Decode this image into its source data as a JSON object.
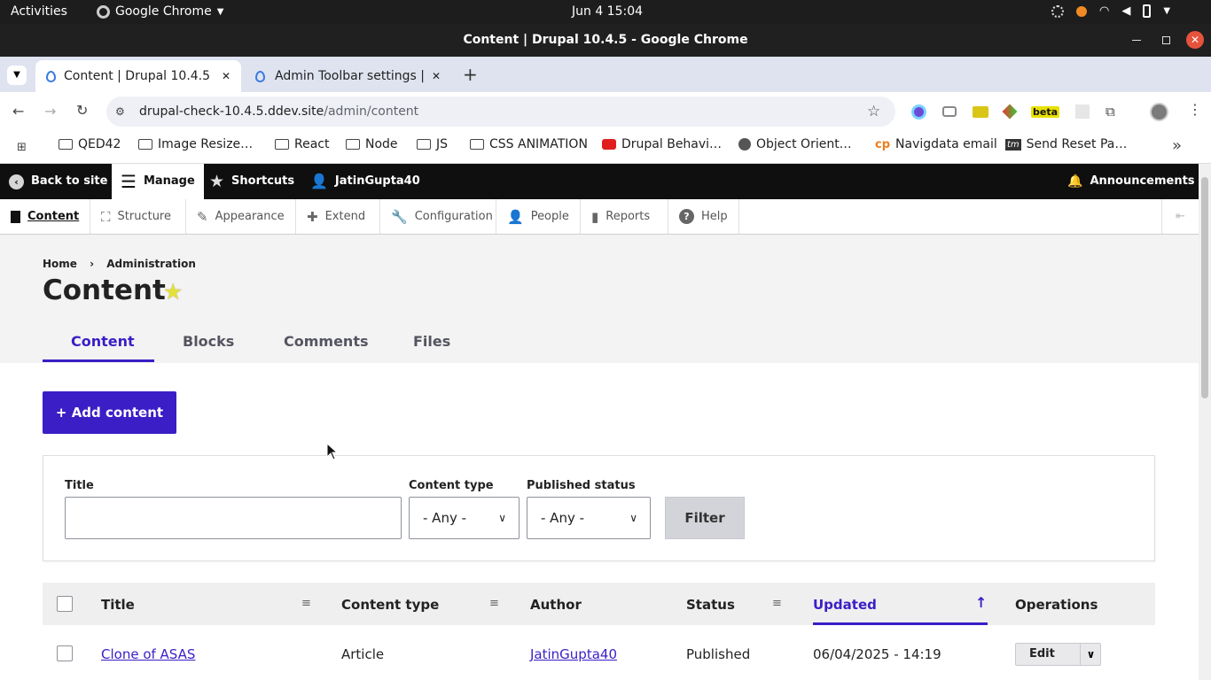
{
  "os": {
    "activities": "Activities",
    "app_name": "Google Chrome",
    "clock": "Jun 4  15:04"
  },
  "window": {
    "title": "Content | Drupal 10.4.5 - Google Chrome"
  },
  "tabs": [
    {
      "label": "Content | Drupal 10.4.5",
      "active": true
    },
    {
      "label": "Admin Toolbar settings |",
      "active": false
    }
  ],
  "address": {
    "host": "drupal-check-10.4.5.ddev.site",
    "path": "/admin/content"
  },
  "bookmarks": [
    {
      "label": "QED42",
      "icon": "folder-icon"
    },
    {
      "label": "Image Resize…",
      "icon": "folder-icon"
    },
    {
      "label": "React",
      "icon": "folder-icon"
    },
    {
      "label": "Node",
      "icon": "folder-icon"
    },
    {
      "label": "JS",
      "icon": "folder-icon"
    },
    {
      "label": "CSS ANIMATION",
      "icon": "folder-icon"
    },
    {
      "label": "Drupal Behavi…",
      "icon": "youtube-icon"
    },
    {
      "label": "Object Orient…",
      "icon": "globe-icon"
    },
    {
      "label": "Navigdata email",
      "icon": "cp-icon"
    },
    {
      "label": "Send Reset Pa…",
      "icon": "tm-icon"
    }
  ],
  "extensions": {
    "beta_badge": "beta"
  },
  "toolbar": {
    "back": "Back to site",
    "manage": "Manage",
    "shortcuts": "Shortcuts",
    "user": "JatinGupta40",
    "announcements": "Announcements"
  },
  "tray": [
    {
      "label": "Content",
      "icon": "page-icon"
    },
    {
      "label": "Structure",
      "icon": "structure-icon"
    },
    {
      "label": "Appearance",
      "icon": "brush-icon"
    },
    {
      "label": "Extend",
      "icon": "puzzle-icon"
    },
    {
      "label": "Configuration",
      "icon": "wrench-icon"
    },
    {
      "label": "People",
      "icon": "person-icon"
    },
    {
      "label": "Reports",
      "icon": "bar-chart-icon"
    },
    {
      "label": "Help",
      "icon": "help-icon"
    }
  ],
  "page": {
    "breadcrumb": [
      "Home",
      "Administration"
    ],
    "breadcrumb_sep": "›",
    "title": "Content",
    "tabs": [
      "Content",
      "Blocks",
      "Comments",
      "Files"
    ],
    "add_button": "+ Add content"
  },
  "filters": {
    "title_label": "Title",
    "title_value": "",
    "type_label": "Content type",
    "type_value": "- Any -",
    "status_label": "Published status",
    "status_value": "- Any -",
    "filter_button": "Filter"
  },
  "table": {
    "headers": [
      "Title",
      "Content type",
      "Author",
      "Status",
      "Updated",
      "Operations"
    ],
    "rows": [
      {
        "title": "Clone of ASAS",
        "type": "Article",
        "author": "JatinGupta40",
        "status": "Published",
        "updated": "06/04/2025 - 14:19",
        "op": "Edit"
      }
    ]
  },
  "colors": {
    "accent": "#3b1ec6",
    "toolbar_bg": "#0f0f0f",
    "star": "#e4e03a"
  }
}
